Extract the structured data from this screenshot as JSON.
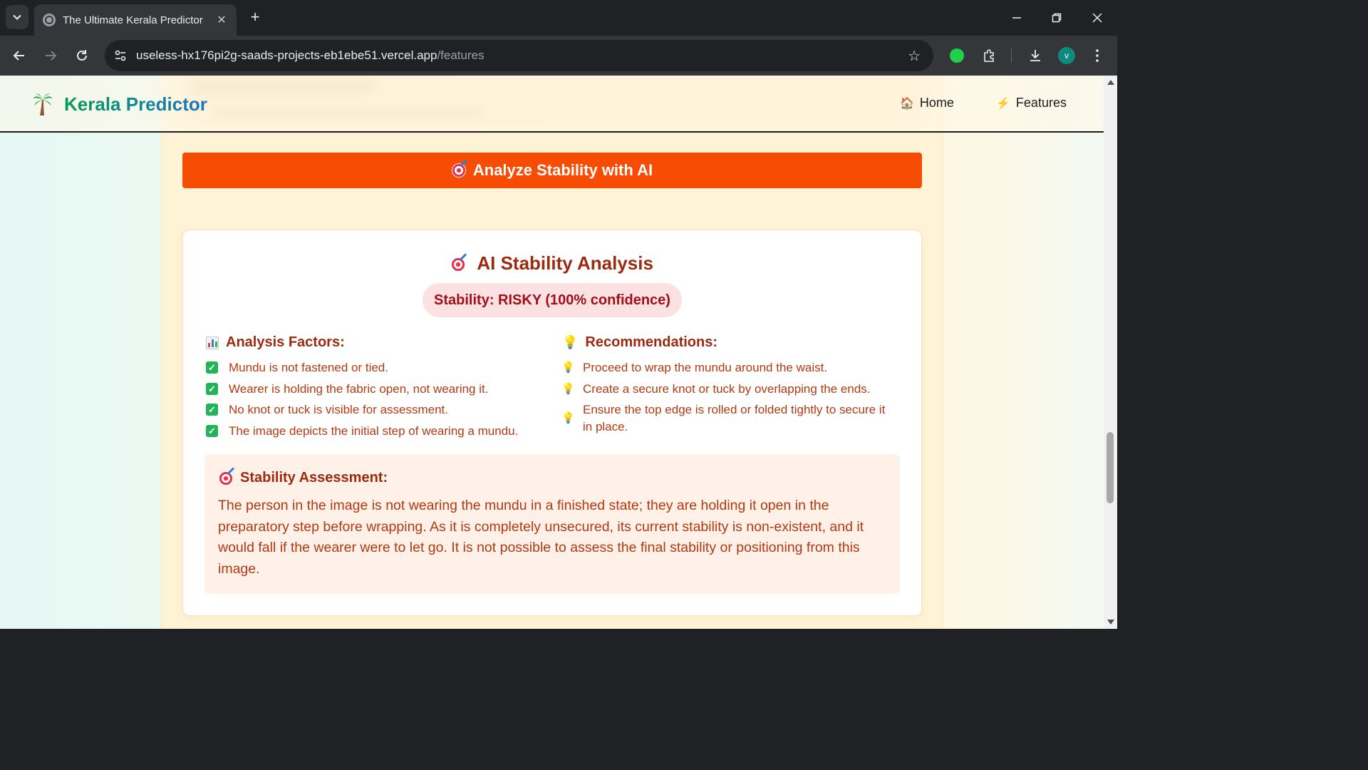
{
  "browser": {
    "tab_title": "The Ultimate Kerala Predictor",
    "url_host": "useless-hx176pi2g-saads-projects-eb1ebe51.vercel.app",
    "url_path": "/features",
    "avatar_initial": "v",
    "icons": [
      "tab-search-icon",
      "globe-icon",
      "close-icon",
      "plus-icon",
      "minimize-icon",
      "restore-icon",
      "window-close-icon",
      "back-icon",
      "forward-icon",
      "reload-icon",
      "site-settings-icon",
      "star-icon",
      "extension-icon",
      "puzzle-icon",
      "download-icon",
      "menu-icon"
    ]
  },
  "site": {
    "brand": "Kerala Predictor",
    "nav": [
      {
        "label": "Home",
        "icon": "house-icon"
      },
      {
        "label": "Features",
        "icon": "lightning-icon"
      }
    ]
  },
  "analyze_button": {
    "label": "Analyze Stability with AI",
    "icon": "target-icon"
  },
  "result": {
    "title": "AI Stability Analysis",
    "stability_label": "Stability: RISKY (100% confidence)",
    "factors_heading": "Analysis Factors:",
    "factors": [
      "Mundu is not fastened or tied.",
      "Wearer is holding the fabric open, not wearing it.",
      "No knot or tuck is visible for assessment.",
      "The image depicts the initial step of wearing a mundu."
    ],
    "recommendations_heading": "Recommendations:",
    "recommendations": [
      "Proceed to wrap the mundu around the waist.",
      "Create a secure knot or tuck by overlapping the ends.",
      "Ensure the top edge is rolled or folded tightly to secure it in place."
    ],
    "assessment_heading": "Stability Assessment:",
    "assessment_text": "The person in the image is not wearing the mundu in a finished state; they are holding it open in the preparatory step before wrapping. As it is completely unsecured, its current stability is non-existent, and it would fall if the wearer were to let go. It is not possible to assess the final stability or positioning from this image."
  },
  "colors": {
    "analyze_button": "#f64c04",
    "heading": "#9c2a10",
    "body_text": "#b23a12",
    "pill_bg": "#fbe1e1",
    "check": "#23b457"
  }
}
